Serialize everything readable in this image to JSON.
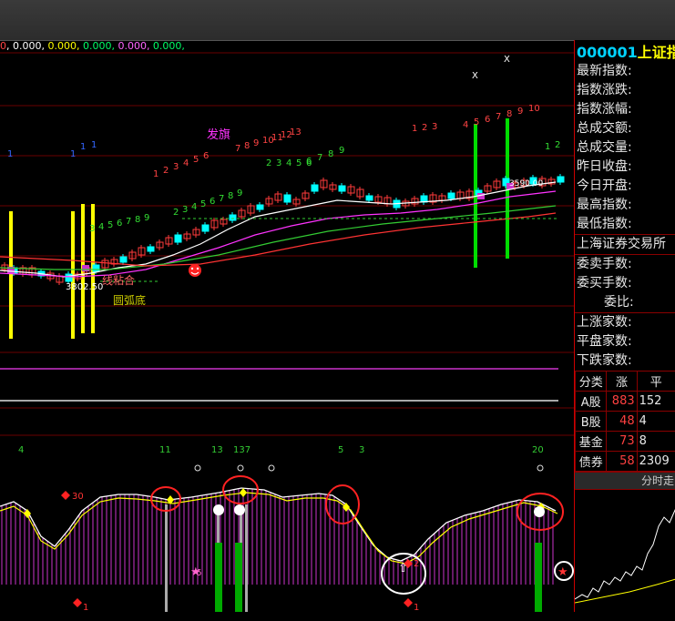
{
  "ma_readout": {
    "prefix": "0",
    "v1": ", 0.000,",
    "v2": " 0.000,",
    "v3": " 0.000,",
    "v4": " 0.000,",
    "v5": " 0.000,"
  },
  "annotations": {
    "fa_qi": "发旗",
    "xian_nian_he": "线粘合",
    "yuan_hu_di": "圆弧底",
    "label_3802": "3802.50",
    "label_3590": "3590.00",
    "x_mark": "X"
  },
  "seq_numbers": {
    "green_run": [
      "3",
      "4",
      "5",
      "6",
      "7",
      "8",
      "9"
    ],
    "green_run2": [
      "2",
      "3",
      "4",
      "5",
      "6",
      "7",
      "8",
      "9"
    ],
    "red_run": [
      "1",
      "2",
      "3",
      "4",
      "5",
      "6"
    ],
    "red_top": [
      "7",
      "8",
      "9",
      "10",
      "11",
      "12",
      "13"
    ],
    "right_red": [
      "1",
      "2",
      "3",
      "4",
      "5",
      "6",
      "7",
      "8",
      "9",
      "10"
    ]
  },
  "lower_counts": [
    "4",
    "11",
    "13",
    "137",
    "5",
    "3",
    "20"
  ],
  "lower_markers": {
    "d30": "30",
    "s6": "6",
    "d2": "2",
    "d1a": "1",
    "d1b": "1"
  },
  "panel": {
    "code": "000001",
    "name": "上证指",
    "rows": [
      "最新指数:",
      "指数涨跌:",
      "指数涨幅:",
      "总成交额:",
      "总成交量:",
      "昨日收盘:",
      "今日开盘:",
      "最高指数:",
      "最低指数:"
    ],
    "exchange": "上海证券交易所",
    "rows2": [
      "委卖手数:",
      "委买手数:"
    ],
    "ratio": "委比:",
    "rows3": [
      "上涨家数:",
      "平盘家数:",
      "下跌家数:"
    ],
    "table_header": [
      "分类",
      "涨",
      "平"
    ],
    "table_rows": [
      [
        "A股",
        "883",
        "152"
      ],
      [
        "B股",
        "48",
        "4"
      ],
      [
        "基金",
        "73",
        "8"
      ],
      [
        "债券",
        "58",
        "2309"
      ]
    ],
    "time_chart_title": "分时走"
  },
  "colors": {
    "up": "#ff3b3b",
    "down": "#00ffff",
    "ma_white": "#ffffff",
    "ma_magenta": "#ff33ff",
    "ma_green": "#33cc33",
    "ma_red": "#ff3333",
    "signal_yellow": "#ffff00",
    "signal_green": "#00dd00",
    "osc_fill": "#cc33cc"
  }
}
